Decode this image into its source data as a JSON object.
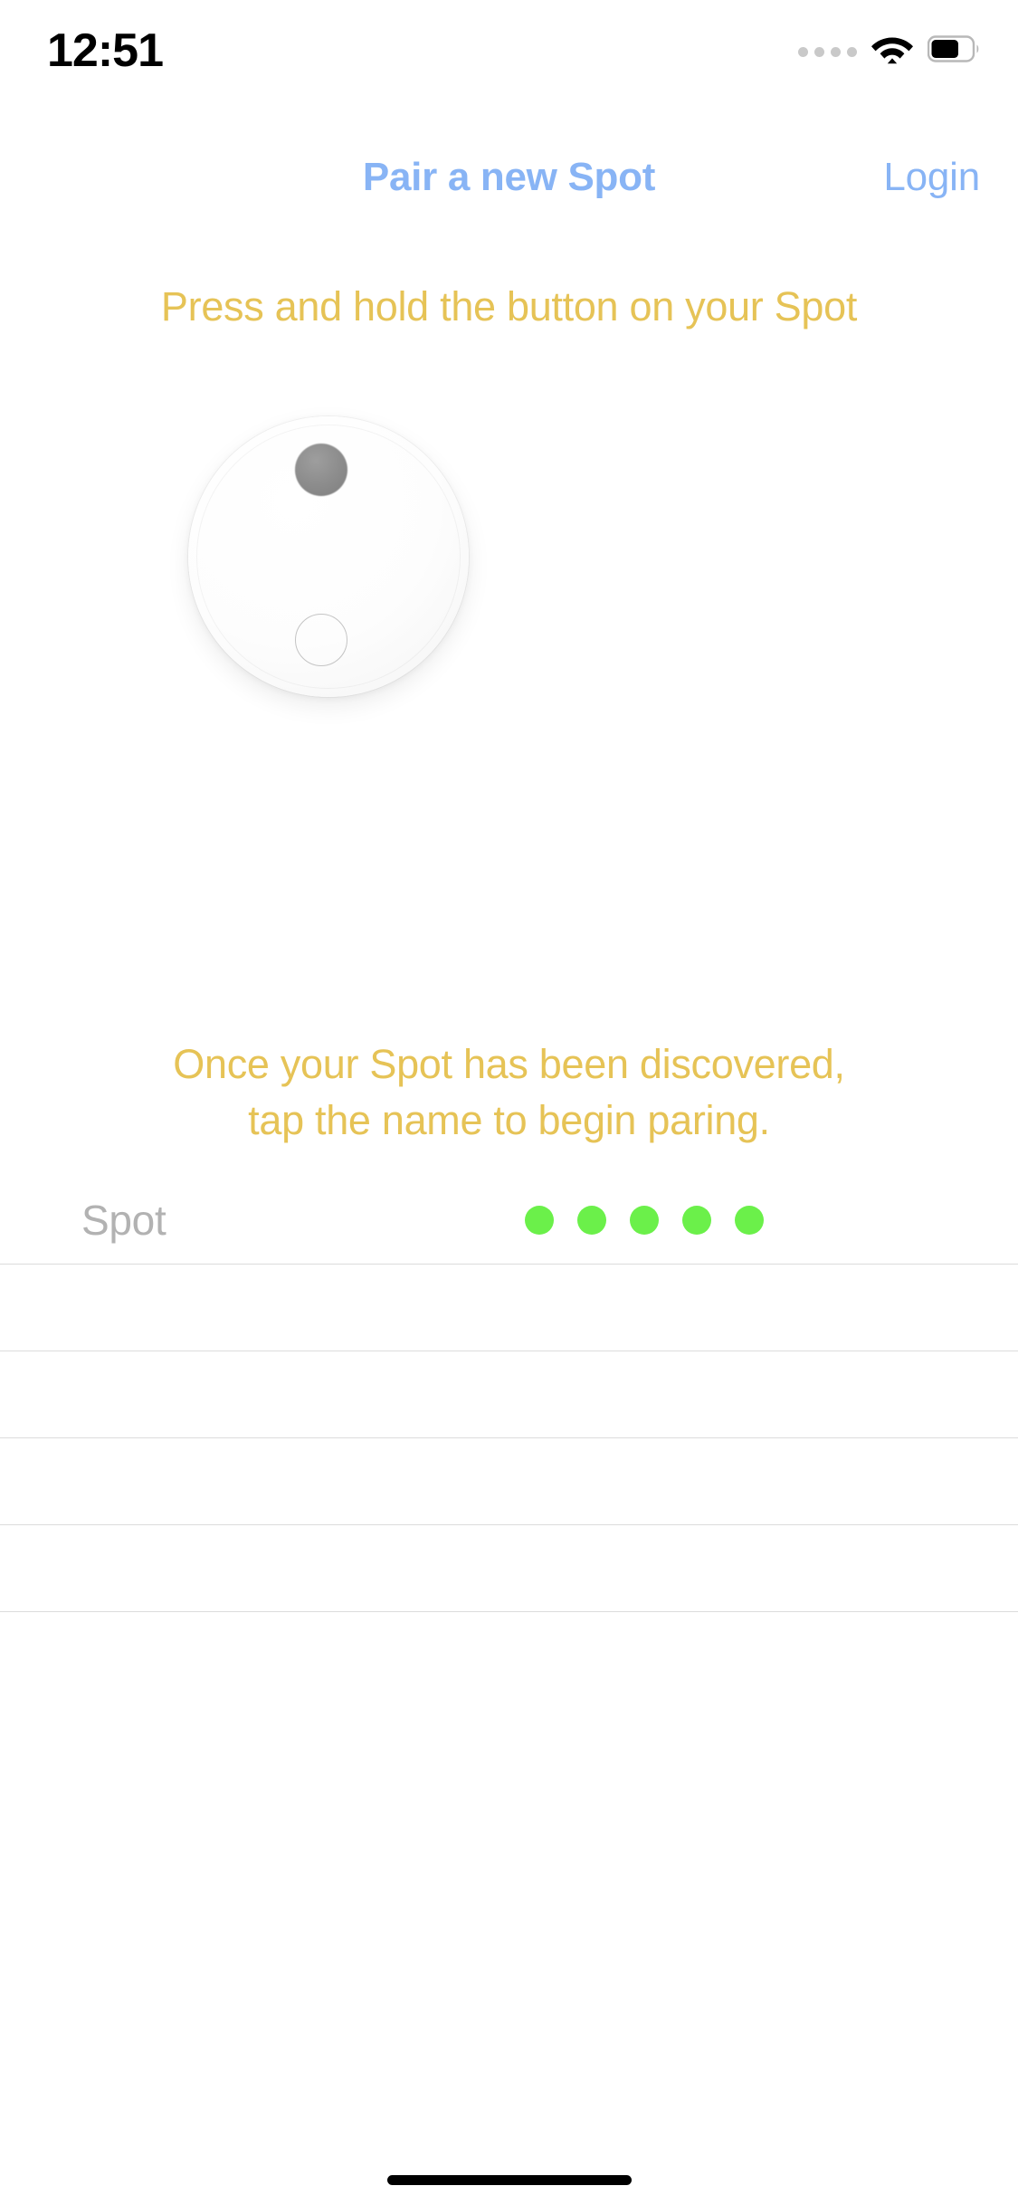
{
  "status_bar": {
    "time": "12:51",
    "signal_icon": "signal-dots-icon",
    "signal_dot_count": 4,
    "wifi_icon": "wifi-icon",
    "battery_icon": "battery-icon",
    "battery_level_percent": 65
  },
  "header": {
    "title": "Pair a new Spot",
    "login_label": "Login",
    "accent_color": "#88b4f5"
  },
  "content": {
    "instruction_top": "Press and hold the button on your Spot",
    "instruction_bottom_line1": "Once your Spot has been discovered,",
    "instruction_bottom_line2": "tap the name to begin paring.",
    "instruction_color": "#e6c356"
  },
  "device_illustration": {
    "puck_icon": "spot-tracker-puck-icon",
    "led_icon": "led-indicator-icon",
    "button_icon": "press-button-icon"
  },
  "device_list": {
    "signal_dot_color": "#6bf04a",
    "rows": [
      {
        "name": "Spot",
        "signal_dots": 5
      },
      {
        "name": "",
        "signal_dots": 0
      },
      {
        "name": "",
        "signal_dots": 0
      },
      {
        "name": "",
        "signal_dots": 0
      },
      {
        "name": "",
        "signal_dots": 0
      },
      {
        "name": "",
        "signal_dots": 0
      }
    ]
  },
  "home_indicator": {
    "label": "home-indicator"
  }
}
